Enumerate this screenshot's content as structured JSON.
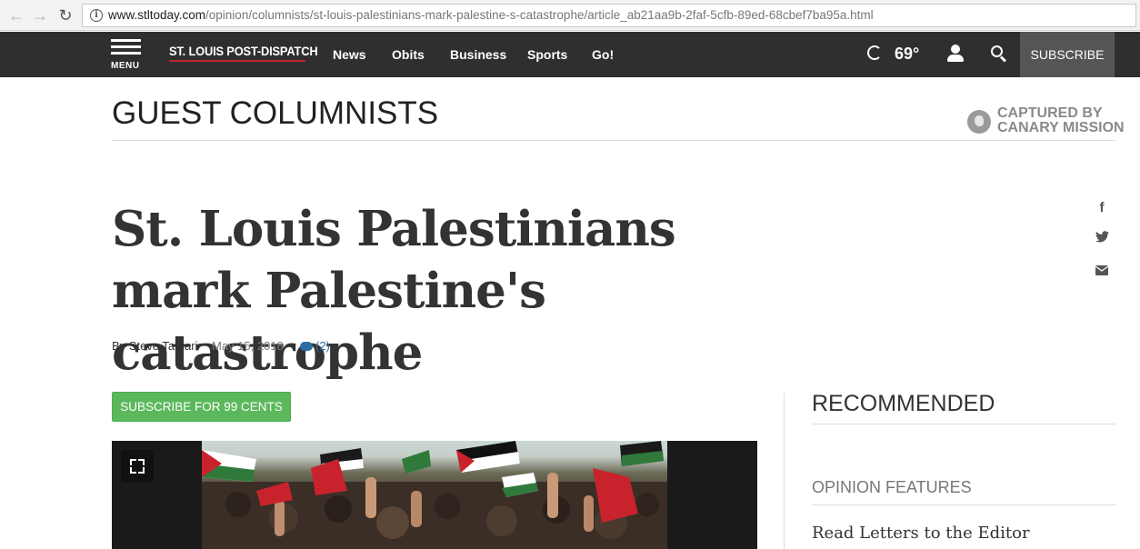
{
  "browser": {
    "url_host": "www.stltoday.com",
    "url_path": "/opinion/columnists/st-louis-palestinians-mark-palestine-s-catastrophe/article_ab21aa9b-2faf-5cfb-89ed-68cbef7ba95a.html"
  },
  "header": {
    "menu_label": "MENU",
    "logo": "ST. LOUIS POST-DISPATCH",
    "nav": [
      "News",
      "Obits",
      "Business",
      "Sports",
      "Go!"
    ],
    "temperature": "69°",
    "subscribe_label": "SUBSCRIBE"
  },
  "section": {
    "title": "GUEST COLUMNISTS",
    "watermark_line1": "CAPTURED BY",
    "watermark_line2": "CANARY MISSION"
  },
  "article": {
    "headline": "St. Louis Palestinians mark Palestine's catastrophe",
    "byline": "By Steve Tamari",
    "date": "May 15, 2018",
    "comments": "(2)",
    "subscribe_button": "SUBSCRIBE FOR 99 CENTS"
  },
  "share_icons": [
    "facebook-icon",
    "twitter-icon",
    "email-icon"
  ],
  "sidebar": {
    "recommended": "RECOMMENDED",
    "opinion_features": "OPINION FEATURES",
    "first_link": "Read Letters to the Editor"
  },
  "colors": {
    "header_bg": "#2f2f2f",
    "subscribe_green": "#5cb85c",
    "link_blue": "#2e6da4",
    "logo_red": "#c0262d"
  }
}
